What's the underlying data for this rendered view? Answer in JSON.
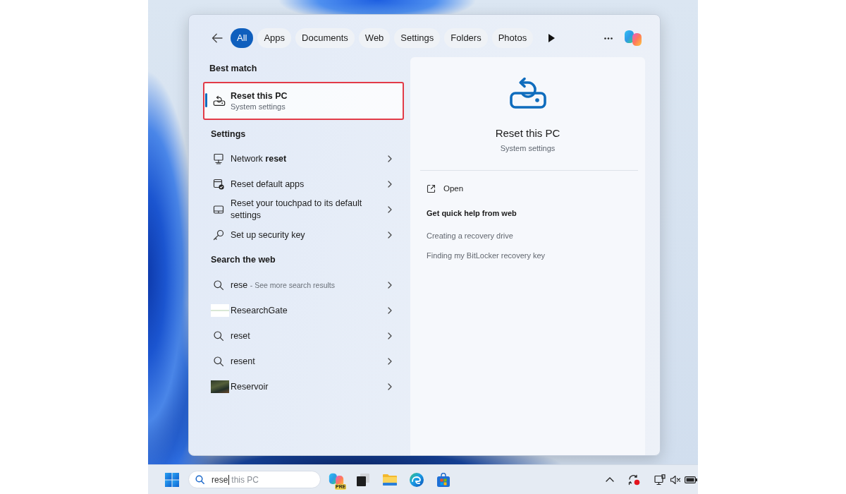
{
  "search_flyout": {
    "filters": [
      {
        "label": "All",
        "selected": true
      },
      {
        "label": "Apps",
        "selected": false
      },
      {
        "label": "Documents",
        "selected": false
      },
      {
        "label": "Web",
        "selected": false
      },
      {
        "label": "Settings",
        "selected": false
      },
      {
        "label": "Folders",
        "selected": false
      },
      {
        "label": "Photos",
        "selected": false
      }
    ],
    "best_match": {
      "heading": "Best match",
      "title": "Reset this PC",
      "subtitle": "System settings",
      "selected": true,
      "highlighted": true
    },
    "settings": {
      "heading": "Settings",
      "items": [
        {
          "label": "Network **reset**"
        },
        {
          "label": "Reset default apps"
        },
        {
          "label": "Reset your touchpad to its default settings"
        },
        {
          "label": "Set up security key"
        }
      ]
    },
    "web": {
      "heading": "Search the web",
      "items": [
        {
          "kind": "query",
          "text": "rese",
          "hint": "- See more search results"
        },
        {
          "kind": "site",
          "text": "ResearchGate"
        },
        {
          "kind": "query",
          "text": "reset"
        },
        {
          "kind": "query",
          "text": "resent"
        },
        {
          "kind": "image",
          "text": "Reservoir"
        }
      ]
    },
    "preview": {
      "title": "Reset this PC",
      "subtitle": "System settings",
      "actions": [
        {
          "label": "Open"
        }
      ],
      "help_heading": "Get quick help from web",
      "help_links": [
        "Creating a recovery drive",
        "Finding my BitLocker recovery key"
      ]
    }
  },
  "taskbar": {
    "search": {
      "value": "rese",
      "suggestion": "this PC"
    },
    "app_badge": "PRE",
    "volume_muted": true
  }
}
